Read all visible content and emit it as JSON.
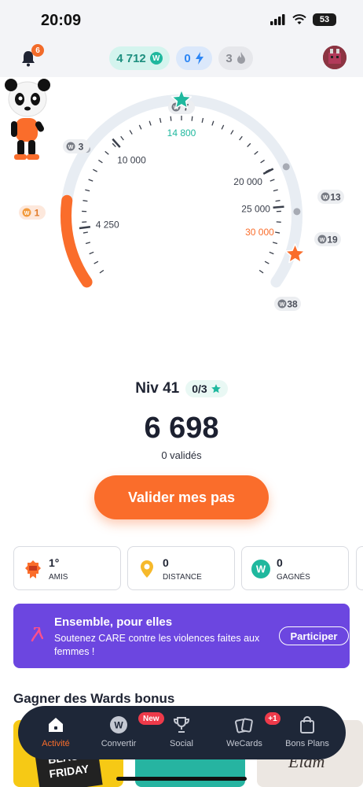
{
  "status_bar": {
    "time": "20:09",
    "battery": "53"
  },
  "top_bar": {
    "notification_count": "6",
    "wards": "4 712",
    "energy": "0",
    "streak": "3"
  },
  "gauge": {
    "scale_marks": [
      {
        "label": "10 000",
        "kind": "tick-label"
      },
      {
        "label": "4 250",
        "kind": "tick-label"
      },
      {
        "label": "14 800",
        "kind": "current-goal"
      },
      {
        "label": "20 000",
        "kind": "tick-label"
      },
      {
        "label": "25 000",
        "kind": "tick-label"
      },
      {
        "label": "30 000",
        "kind": "max-goal"
      }
    ],
    "rewards": [
      "1",
      "3",
      "7",
      "13",
      "19",
      "38"
    ],
    "progress_fraction": 0.17
  },
  "level": {
    "label": "Niv 41",
    "stars": "0/3"
  },
  "steps": {
    "count": "6 698",
    "validated": "0 validés"
  },
  "cta_label": "Valider mes pas",
  "stats": [
    {
      "value": "1°",
      "label": "AMIS",
      "icon": "ranking-badge-icon"
    },
    {
      "value": "0",
      "label": "DISTANCE",
      "icon": "location-pin-icon"
    },
    {
      "value": "0",
      "label": "GAGNÉS",
      "icon": "wards-coin-icon"
    }
  ],
  "banner": {
    "title": "Ensemble, pour elles",
    "text": "Soutenez CARE contre les violences faites aux femmes !",
    "button": "Participer"
  },
  "section_title": "Gagner des Wards bonus",
  "promos": [
    {
      "text": "BLACK FRIDAY"
    },
    {
      "text": ""
    },
    {
      "text": "Elam"
    }
  ],
  "nav": {
    "items": [
      {
        "label": "Activité",
        "icon": "home-icon",
        "active": true
      },
      {
        "label": "Convertir",
        "icon": "wards-coin-icon",
        "badge": "New"
      },
      {
        "label": "Social",
        "icon": "trophy-icon"
      },
      {
        "label": "WeCards",
        "icon": "cards-icon",
        "badge": "+1"
      },
      {
        "label": "Bons Plans",
        "icon": "shopping-bag-icon"
      }
    ]
  },
  "colors": {
    "accent_orange": "#fa6d2b",
    "teal": "#1fb89e",
    "banner_purple": "#6c46e0",
    "nav_dark": "#1e2738"
  }
}
